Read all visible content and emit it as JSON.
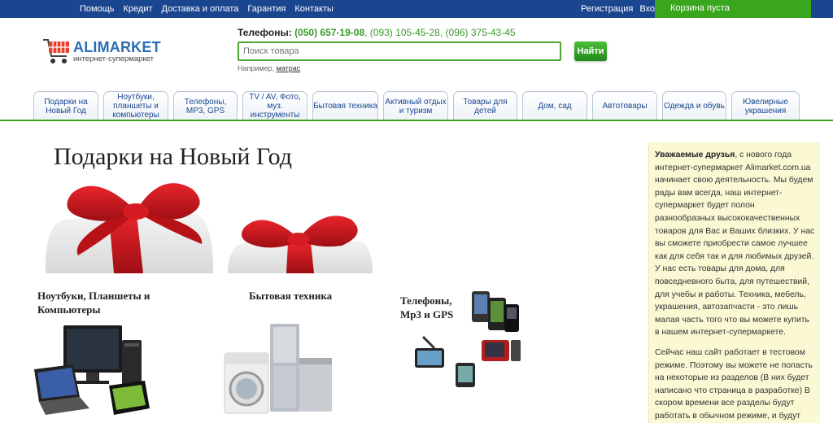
{
  "topnav": [
    "Помощь",
    "Кредит",
    "Доставка и оплата",
    "Гарантия",
    "Контакты"
  ],
  "account": {
    "register": "Регистрация",
    "login": "Вход"
  },
  "cart": {
    "label": "Корзина пуста"
  },
  "logo": {
    "name": "ALIMARKET",
    "subtitle": "интернет-супермаркет"
  },
  "phones": {
    "label": "Телефоны:",
    "main": "(050) 657-19-08",
    "others": ", (093) 105-45-28, (096) 375-43-45"
  },
  "search": {
    "placeholder": "Поиск товара",
    "button": "Найти",
    "hint_prefix": "Например,",
    "hint_example": "матрас"
  },
  "tabs": [
    "Подарки на Новый Год",
    "Ноутбуки, планшеты и компьютеры",
    "Телефоны, МР3, GPS",
    "TV / AV, Фото, муз. инструменты",
    "Бытовая техника",
    "Активный отдых и туризм",
    "Товары для детей",
    "Дом, сад",
    "Автотовары",
    "Одежда и обувь",
    "Ювелирные украшения"
  ],
  "promo": {
    "title": "Подарки на Новый Год"
  },
  "categories": {
    "laptops": "Ноутбуки, Планшеты и Компьютеры",
    "appliances": "Бытовая техника",
    "phones": "Телефоны, Мр3 и GPS"
  },
  "info": {
    "greeting": "Уважаемые друзья",
    "p1": ", с нового года интернет-супермаркет Alimarket.com.ua начинает свою деятельность. Мы будем рады вам всегда, наш интернет-супермаркет будет полон разнообразных высококачественных товаров для Вас и Ваших близких. У нас вы сможете приобрести самое лучшее как для себя так и для любимых друзей. У нас есть товары для дома, для повседневного быта, для путешествий, для учебы и работы. Техника, мебель, украшения, автозапчасти - это лишь малая часть того что вы можете купить в нашем интернет-супермаркете.",
    "p2": "Сейчас наш сайт работает в тестовом режиме. Поэтому вы можете не попасть на некоторые из разделов (В них будет написано что страница в разработке) В скором времени все разделы будут работать в обычном режиме, и будут"
  },
  "colors": {
    "topbar": "#1a4690",
    "accent_green": "#3aa61e",
    "link_blue": "#1a4690",
    "ribbon_red": "#c8161d",
    "info_bg": "#fbf8d4"
  }
}
